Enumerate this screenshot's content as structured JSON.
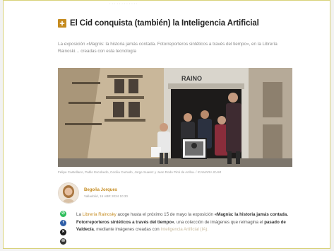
{
  "page": {
    "top_crumb": "· · · · · · · · · · · ·"
  },
  "article": {
    "title": "El Cid conquista (también) la Inteligencia Artificial",
    "subtitle": "La exposición «Magnis: la historia jamás contada. Fotorreporteros sintéticos a través del tiempo», en la Librería Rainoski… creadas con esta tecnología",
    "caption": "Felipe Castellano, Pablo Escobedo, Cecilia Carrado, Jorge Suarez y Juan Rodo Pinti de Arriba. / ICAMARA ICAM",
    "author": {
      "name": "Begoña Jorques",
      "date": "Valladolid, 15 ABR 2024 10:30"
    },
    "body": {
      "p1": "La ",
      "p1_link": "Librería Rainosky",
      "p2": " acoge hasta el próximo 15 de mayo la exposición ",
      "p2_bold": "«Magnia: la historia jamás contada. Fotorreporteros sintéticos a través del tiempo»",
      "p3": ", una colección de imágenes que reimagina el ",
      "p3_bold": "pasado de Valdecía",
      "p4": ", mediante imágenes creadas con ",
      "p4_faint": "Inteligencia Artificial (IA)."
    }
  },
  "share": {
    "whatsapp_glyph": "✆",
    "facebook_glyph": "f",
    "x_glyph": "✕",
    "mail_glyph": "✉"
  },
  "colors": {
    "accent": "#c58b1f",
    "frame_border": "#d8d27a",
    "whatsapp": "#2dbd5a",
    "facebook": "#2f5fa8"
  }
}
